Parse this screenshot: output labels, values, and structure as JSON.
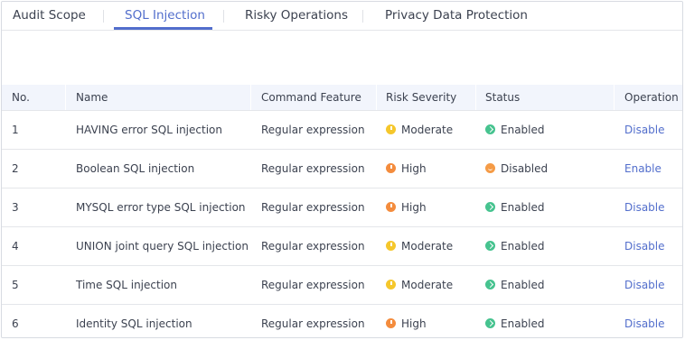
{
  "tabs": [
    {
      "label": "Audit Scope",
      "active": false
    },
    {
      "label": "SQL Injection",
      "active": true
    },
    {
      "label": "Risky Operations",
      "active": false
    },
    {
      "label": "Privacy Data Protection",
      "active": false
    }
  ],
  "table": {
    "headers": {
      "no": "No.",
      "name": "Name",
      "feature": "Command Feature",
      "severity": "Risk Severity",
      "status": "Status",
      "operation": "Operation"
    },
    "rows": [
      {
        "no": "1",
        "name": "HAVING error SQL injection",
        "feature": "Regular expression",
        "severity": "Moderate",
        "severity_level": "moderate",
        "status": "Enabled",
        "status_state": "enabled",
        "operation": "Disable"
      },
      {
        "no": "2",
        "name": "Boolean SQL injection",
        "feature": "Regular expression",
        "severity": "High",
        "severity_level": "high",
        "status": "Disabled",
        "status_state": "disabled",
        "operation": "Enable"
      },
      {
        "no": "3",
        "name": "MYSQL error type SQL injection",
        "feature": "Regular expression",
        "severity": "High",
        "severity_level": "high",
        "status": "Enabled",
        "status_state": "enabled",
        "operation": "Disable"
      },
      {
        "no": "4",
        "name": "UNION joint query SQL injection",
        "feature": "Regular expression",
        "severity": "Moderate",
        "severity_level": "moderate",
        "status": "Enabled",
        "status_state": "enabled",
        "operation": "Disable"
      },
      {
        "no": "5",
        "name": "Time SQL injection",
        "feature": "Regular expression",
        "severity": "Moderate",
        "severity_level": "moderate",
        "status": "Enabled",
        "status_state": "enabled",
        "operation": "Disable"
      },
      {
        "no": "6",
        "name": "Identity SQL injection",
        "feature": "Regular expression",
        "severity": "High",
        "severity_level": "high",
        "status": "Enabled",
        "status_state": "enabled",
        "operation": "Disable"
      }
    ]
  },
  "colors": {
    "accent": "#526ecc",
    "moderate": "#f5c72c",
    "high": "#f48c3d",
    "enabled": "#46c38f",
    "disabled": "#f59b46",
    "header_bg": "#f2f5fc"
  }
}
